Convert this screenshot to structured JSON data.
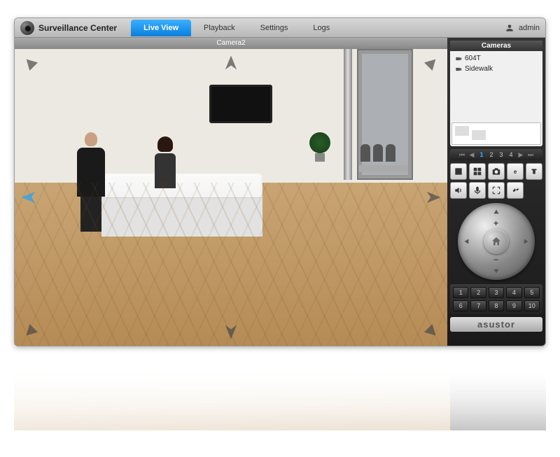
{
  "app": {
    "title": "Surveillance Center"
  },
  "nav": {
    "live_view": "Live View",
    "playback": "Playback",
    "settings": "Settings",
    "logs": "Logs"
  },
  "user": {
    "name": "admin"
  },
  "viewport": {
    "camera_label": "Camera2"
  },
  "sidebar": {
    "cameras_header": "Cameras",
    "camera_list": [
      {
        "label": "604T"
      },
      {
        "label": "Sidewalk"
      }
    ],
    "pagination": {
      "prev_all": "⏮",
      "prev": "◀",
      "pages": [
        "1",
        "2",
        "3",
        "4"
      ],
      "active_page": "1",
      "next": "▶",
      "next_all": "⏭"
    },
    "icon_row": {
      "layout1": "layout-1",
      "layout2": "layout-grid",
      "snapshot": "snapshot",
      "estream": "estream",
      "record": "record",
      "speaker": "speaker",
      "mic": "mic",
      "expand": "expand",
      "tools": "tools"
    },
    "presets": [
      "1",
      "2",
      "3",
      "4",
      "5",
      "6",
      "7",
      "8",
      "9",
      "10"
    ],
    "brand": "asustor"
  }
}
